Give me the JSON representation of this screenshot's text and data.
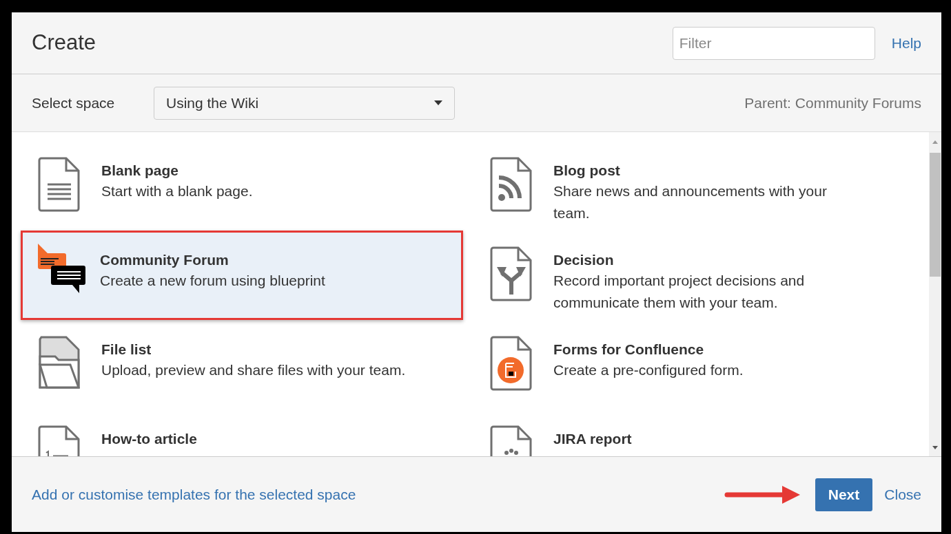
{
  "dialog": {
    "title": "Create",
    "filter": {
      "placeholder": "Filter"
    },
    "help": "Help"
  },
  "space": {
    "label": "Select space",
    "value": "Using the Wiki",
    "parent": "Parent: Community Forums"
  },
  "templates": [
    {
      "title": "Blank page",
      "description": "Start with a blank page.",
      "selected": false
    },
    {
      "title": "Blog post",
      "description": "Share news and announcements with your team.",
      "selected": false
    },
    {
      "title": "Community Forum",
      "description": "Create a new forum using blueprint",
      "selected": true
    },
    {
      "title": "Decision",
      "description": "Record important project decisions and communicate them with your team.",
      "selected": false
    },
    {
      "title": "File list",
      "description": "Upload, preview and share files with your team.",
      "selected": false
    },
    {
      "title": "Forms for Confluence",
      "description": "Create a pre-configured form.",
      "selected": false
    },
    {
      "title": "How-to article",
      "selected": false
    },
    {
      "title": "JIRA report",
      "selected": false
    }
  ],
  "footer": {
    "link": "Add or customise templates for the selected space",
    "next": "Next",
    "close": "Close"
  }
}
